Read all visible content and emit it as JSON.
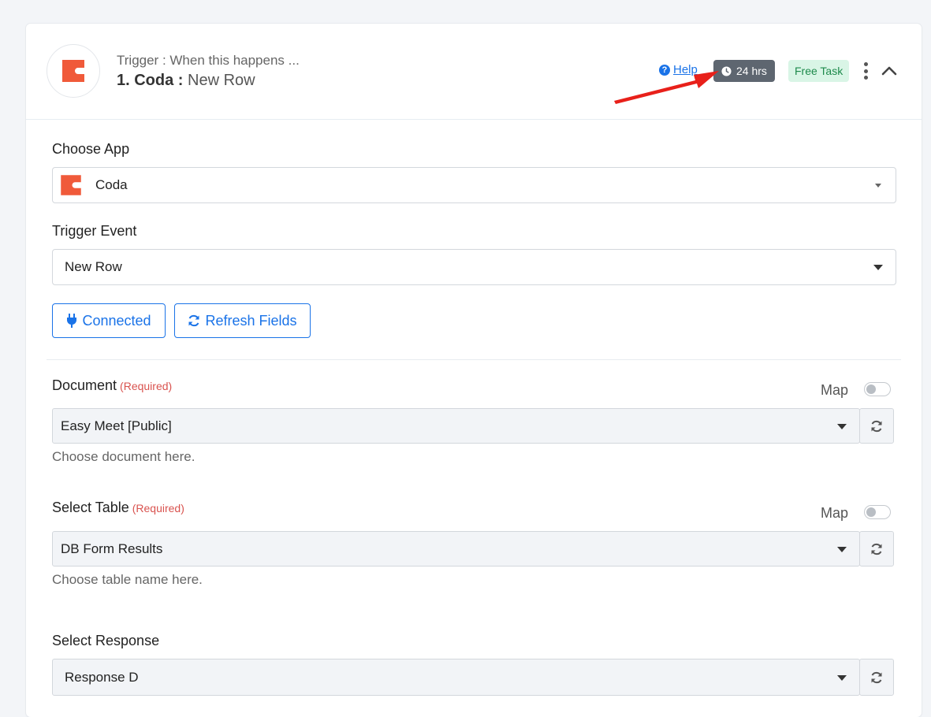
{
  "header": {
    "trigger_subtitle": "Trigger : When this happens ...",
    "step_title": "1. Coda :",
    "step_event": "New Row",
    "help_label": "Help",
    "time_badge": "24 hrs",
    "task_badge": "Free Task"
  },
  "choose_app": {
    "label": "Choose App",
    "value": "Coda"
  },
  "trigger_event": {
    "label": "Trigger Event",
    "value": "New Row"
  },
  "buttons": {
    "connected_label": "Connected",
    "refresh_label": "Refresh Fields"
  },
  "document": {
    "label": "Document",
    "required": "(Required)",
    "map_label": "Map",
    "value": "Easy Meet [Public]",
    "hint": "Choose document here."
  },
  "select_table": {
    "label": "Select Table",
    "required": "(Required)",
    "map_label": "Map",
    "value": "DB Form Results",
    "hint": "Choose table name here."
  },
  "select_response": {
    "label": "Select Response",
    "value": "Response D"
  },
  "colors": {
    "coda_brand": "#f05a3a",
    "link_blue": "#1a73e8",
    "required_red": "#d9534f",
    "badge_gray": "#5e6670",
    "free_green_bg": "#d9f5e6",
    "annotation_arrow": "#e8201a"
  }
}
